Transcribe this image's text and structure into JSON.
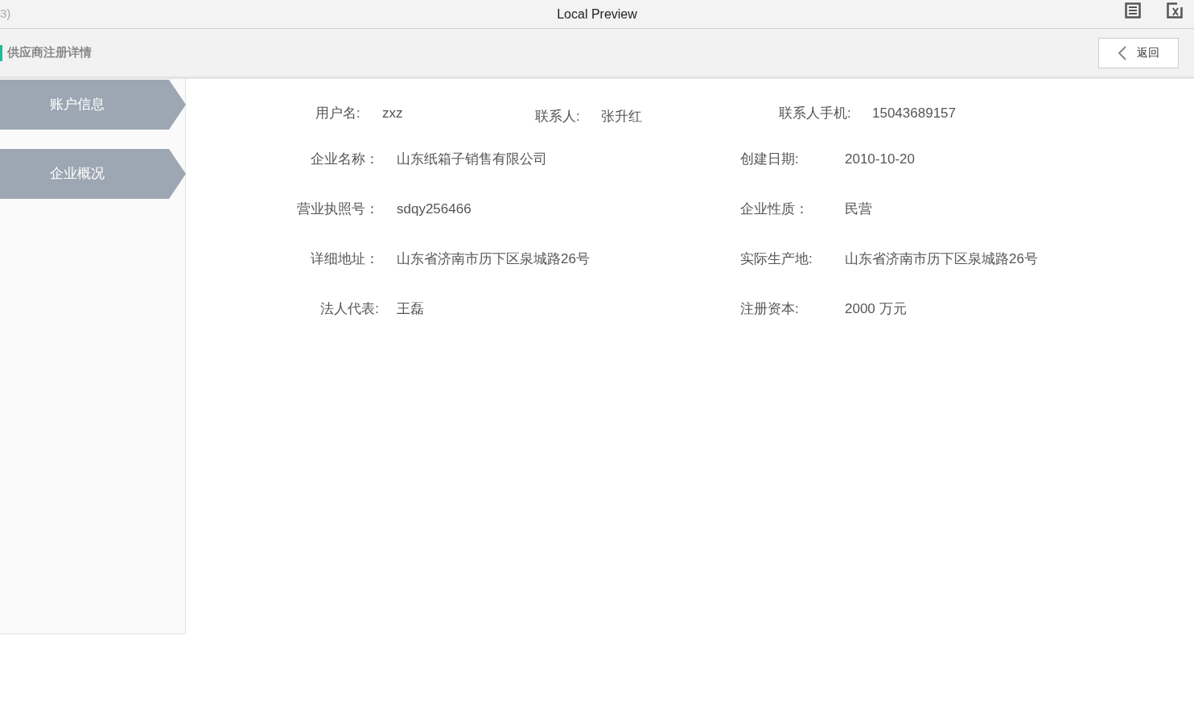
{
  "window": {
    "title": "Local Preview",
    "corner_text": "3)"
  },
  "header": {
    "title": "供应商注册详情",
    "back_button": "返回"
  },
  "sidebar": {
    "items": [
      {
        "label": "账户信息"
      },
      {
        "label": "企业概况"
      }
    ]
  },
  "account": [
    {
      "label": "用户名:",
      "value": "zxz"
    },
    {
      "label": "联系人:",
      "value": "张升红"
    },
    {
      "label": "联系人手机:",
      "value": "15043689157"
    }
  ],
  "company": [
    {
      "left": {
        "label": "企业名称：",
        "value": "山东纸箱子销售有限公司"
      },
      "right": {
        "label": "创建日期:",
        "value": "2010-10-20"
      }
    },
    {
      "left": {
        "label": "营业执照号：",
        "value": "sdqy256466"
      },
      "right": {
        "label": "企业性质：",
        "value": "民营"
      }
    },
    {
      "left": {
        "label": "详细地址：",
        "value": "山东省济南市历下区泉城路26号"
      },
      "right": {
        "label": "实际生产地:",
        "value": "山东省济南市历下区泉城路26号"
      }
    },
    {
      "left": {
        "label": "法人代表:",
        "value": "王磊"
      },
      "right": {
        "label": "注册资本:",
        "value": "2000 万元"
      }
    }
  ]
}
